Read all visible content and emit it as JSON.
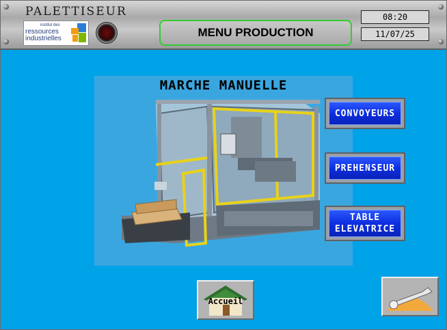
{
  "header": {
    "app_title": "PALETTISEUR",
    "logo": {
      "line1": "institut des",
      "line2": "ressources",
      "line3": "industrielles"
    },
    "screen_title": "MENU PRODUCTION",
    "time": "08:20",
    "date": "11/07/25"
  },
  "main": {
    "section_title": "MARCHE MANUELLE",
    "buttons": [
      {
        "label": "CONVOYEURS"
      },
      {
        "label": "PREHENSEUR"
      },
      {
        "label": "TABLE\nELEVATRICE"
      }
    ]
  },
  "footer": {
    "home_label": "Accueil",
    "tools_icon": "wrench-icon"
  },
  "colors": {
    "background": "#00a2e8",
    "button_blue": "#0d2fe0",
    "menu_border": "#33cc33"
  }
}
